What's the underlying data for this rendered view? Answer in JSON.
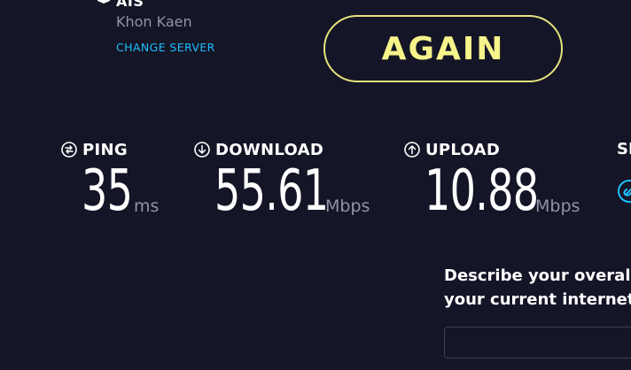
{
  "server": {
    "isp": "AIS",
    "location": "Khon Kaen",
    "change_label": "CHANGE SERVER"
  },
  "again_label": "AGAIN",
  "metrics": {
    "ping": {
      "label": "PING",
      "value": "35",
      "unit": "ms"
    },
    "download": {
      "label": "DOWNLOAD",
      "value": "55.61",
      "unit": "Mbps"
    },
    "upload": {
      "label": "UPLOAD",
      "value": "10.88",
      "unit": "Mbps"
    },
    "partial": {
      "label": "SE"
    }
  },
  "survey": {
    "line1": "Describe your overall",
    "line2": "your current internet"
  },
  "colors": {
    "background": "#141526",
    "accent_yellow": "#f7f48b",
    "link_blue": "#1cbfff",
    "muted_text": "#9193a8"
  },
  "icons": {
    "server": "server-icon",
    "ping": "ping-icon",
    "download": "download-arrow-icon",
    "upload": "upload-arrow-icon",
    "partial": "link-icon"
  }
}
